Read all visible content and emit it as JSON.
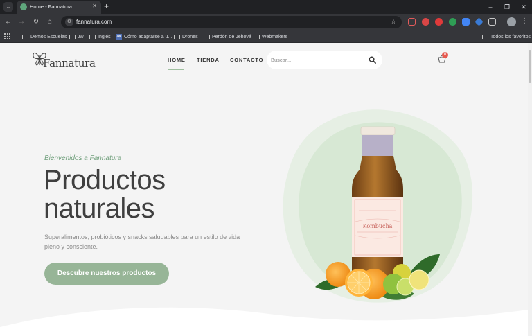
{
  "browser": {
    "tab_title": "Home - Fannatura",
    "url": "fannatura.com",
    "bookmarks": [
      {
        "label": "Demos Escuelas",
        "icon": "folder-icon"
      },
      {
        "label": "Jw",
        "icon": "folder-icon"
      },
      {
        "label": "Inglés",
        "icon": "folder-icon"
      },
      {
        "label": "Cómo adaptarse a u...",
        "icon": "jw-icon"
      },
      {
        "label": "Drones",
        "icon": "folder-icon"
      },
      {
        "label": "Perdón de Jehová",
        "icon": "folder-icon"
      },
      {
        "label": "Webmakers",
        "icon": "folder-icon"
      }
    ],
    "all_bookmarks_label": "Todos los favoritos"
  },
  "site": {
    "logo_text": "Fannatura",
    "nav": [
      {
        "label": "HOME",
        "active": true
      },
      {
        "label": "TIENDA",
        "active": false
      },
      {
        "label": "CONTACTO",
        "active": false
      }
    ],
    "search_placeholder": "Buscar...",
    "cart_count": "0"
  },
  "hero": {
    "welcome": "Bienvenidos a Fannatura",
    "headline_line1": "Productos",
    "headline_line2": "naturales",
    "subtext": "Superalimentos, probióticos y snacks saludables para un estilo de vida pleno y consciente.",
    "cta_label": "Descubre nuestros productos",
    "product_label_title": "Kombucha"
  },
  "colors": {
    "accent_green": "#97b597",
    "welcome_green": "#6e9e7a",
    "badge_red": "#e65a50"
  }
}
